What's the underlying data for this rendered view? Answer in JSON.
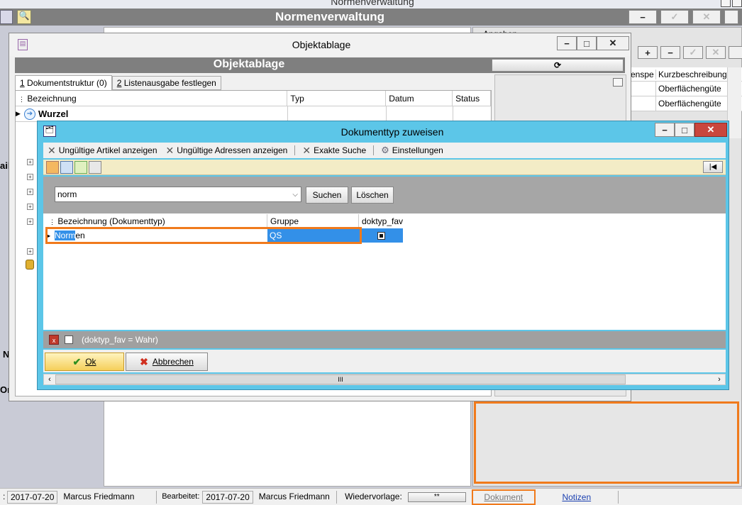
{
  "bg_window": {
    "top_title": "Normenverwaltung",
    "header_title": "Normenverwaltung",
    "angaben_label": "Angaben",
    "right_table": {
      "col_spe": "enspe",
      "col_kurz": "Kurzbeschreibung",
      "rows": [
        "Oberflächengüte",
        "Oberflächengüte"
      ]
    },
    "left_labels": [
      "ail",
      "N",
      "Or"
    ]
  },
  "objektablage": {
    "window_title": "Objektablage",
    "header_title": "Objektablage",
    "tabs": [
      {
        "num": "1",
        "label": " Dokumentstruktur (0)"
      },
      {
        "num": "2",
        "label": " Listenausgabe festlegen"
      }
    ],
    "columns": [
      "Bezeichnung",
      "Typ",
      "Datum",
      "Status"
    ],
    "root_label": "Wurzel"
  },
  "dialog": {
    "title": "Dokumenttyp zuweisen",
    "toolbar": {
      "invalid_articles": "Ungültige Artikel anzeigen",
      "invalid_addresses": "Ungültige Adressen anzeigen",
      "exact_search": "Exakte Suche",
      "settings": "Einstellungen"
    },
    "search": {
      "value": "norm",
      "search_btn": "Suchen",
      "clear_btn": "Löschen"
    },
    "grid": {
      "columns": [
        "Bezeichnung (Dokumenttyp)",
        "Gruppe",
        "doktyp_fav"
      ],
      "rows": [
        {
          "name_match": "Norm",
          "name_rest": "en",
          "group": "QS"
        }
      ]
    },
    "filter_text": "(doktyp_fav = Wahr)",
    "ok_label": "Ok",
    "cancel_label": "Abbrechen",
    "scroll_grip": "III"
  },
  "statusbar": {
    "created_date": "2017-07-20",
    "created_user": "Marcus Friedmann",
    "edited_label": "Bearbeitet:",
    "edited_date": "2017-07-20",
    "edited_user": "Marcus Friedmann",
    "resubmit_label": "Wiedervorlage:",
    "resubmit_value": "**",
    "tab_document": "Dokument",
    "tab_notes": "Notizen"
  },
  "colors": {
    "dialog_title": "#5cc6e8",
    "header_bar": "#7f7f7f",
    "selection": "#3390e8",
    "highlight_border": "#f07a1c"
  }
}
